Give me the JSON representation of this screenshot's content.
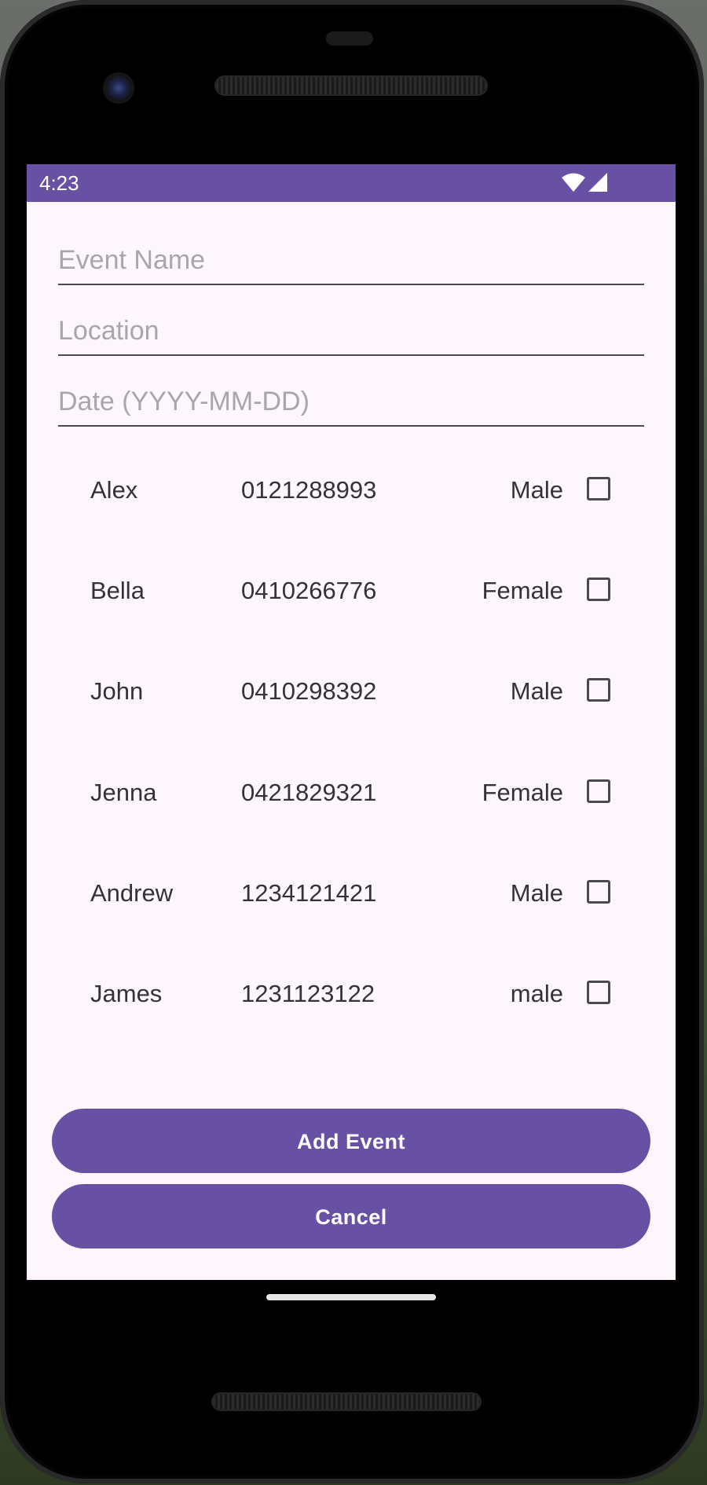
{
  "status_bar": {
    "time": "4:23",
    "background_color": "#6850a4",
    "icons": [
      "wifi-icon",
      "signal-icon"
    ]
  },
  "form": {
    "event_name": {
      "placeholder": "Event Name",
      "value": ""
    },
    "location": {
      "placeholder": "Location",
      "value": ""
    },
    "date": {
      "placeholder": "Date (YYYY-MM-DD)",
      "value": ""
    }
  },
  "contacts": [
    {
      "name": "Alex",
      "phone": "0121288993",
      "gender": "Male",
      "checked": false
    },
    {
      "name": "Bella",
      "phone": "0410266776",
      "gender": "Female",
      "checked": false
    },
    {
      "name": "John",
      "phone": "0410298392",
      "gender": "Male",
      "checked": false
    },
    {
      "name": "Jenna",
      "phone": "0421829321",
      "gender": "Female",
      "checked": false
    },
    {
      "name": "Andrew",
      "phone": "1234121421",
      "gender": "Male",
      "checked": false
    },
    {
      "name": "James",
      "phone": "1231123122",
      "gender": "male",
      "checked": false
    }
  ],
  "buttons": {
    "add_event_label": "Add Event",
    "cancel_label": "Cancel",
    "color": "#6851a5"
  }
}
